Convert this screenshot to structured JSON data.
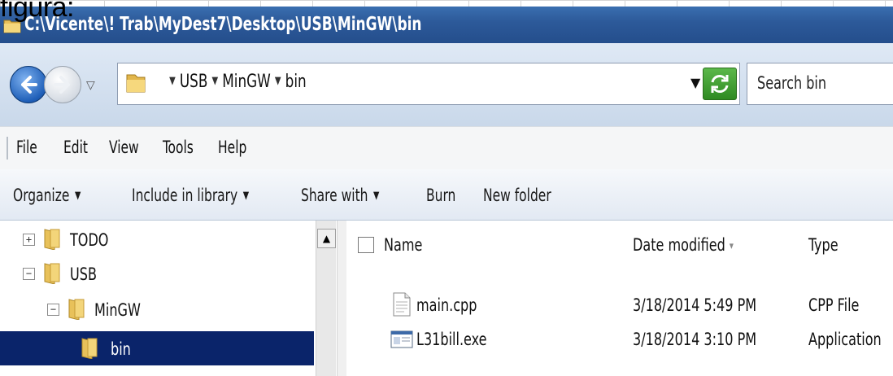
{
  "caption": "figura:",
  "window": {
    "title": "C:\\Vicente\\! Trab\\MyDest7\\Desktop\\USB\\MinGW\\bin"
  },
  "address": {
    "crumbs": [
      "USB",
      "MinGW",
      "bin"
    ],
    "search_placeholder": "Search bin"
  },
  "menu": {
    "items": [
      "File",
      "Edit",
      "View",
      "Tools",
      "Help"
    ]
  },
  "commands": {
    "organize": "Organize",
    "include_in_library": "Include in library",
    "share_with": "Share with",
    "burn": "Burn",
    "new_folder": "New folder"
  },
  "nav_tree": [
    {
      "label": "TODO",
      "expander": "+",
      "selected": false
    },
    {
      "label": "USB",
      "expander": "−",
      "selected": false
    },
    {
      "label": "MinGW",
      "expander": "−",
      "selected": false
    },
    {
      "label": "bin",
      "expander": "",
      "selected": true
    }
  ],
  "columns": {
    "name": "Name",
    "date_modified": "Date modified",
    "type": "Type"
  },
  "files": [
    {
      "name": "main.cpp",
      "date": "3/18/2014 5:49 PM",
      "type": "CPP File",
      "icon": "text-file-icon"
    },
    {
      "name": "L31bill.exe",
      "date": "3/18/2014 3:10 PM",
      "type": "Application",
      "icon": "exe-file-icon"
    }
  ],
  "colors": {
    "titlebar": "#2d5a9a",
    "selection": "#0a246a"
  }
}
